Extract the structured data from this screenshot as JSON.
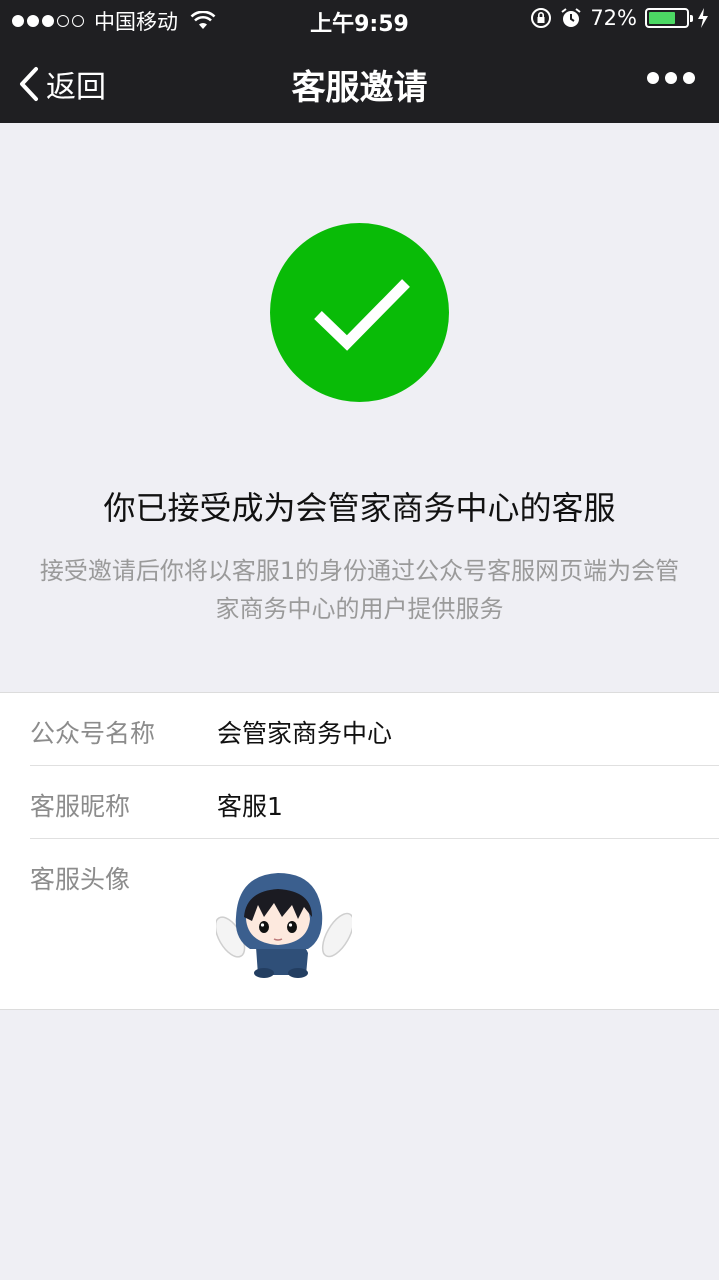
{
  "status_bar": {
    "carrier": "中国移动",
    "time": "上午9:59",
    "battery_percent": "72%",
    "battery_level": 0.72,
    "signal_bars_filled": 3,
    "signal_bars_total": 5
  },
  "nav": {
    "back_label": "返回",
    "title": "客服邀请"
  },
  "result": {
    "icon": "success-check-icon",
    "accent_color": "#09bb07",
    "headline": "你已接受成为会管家商务中心的客服",
    "description": "接受邀请后你将以客服1的身份通过公众号客服网页端为会管家商务中心的用户提供服务"
  },
  "info": {
    "rows": [
      {
        "label": "公众号名称",
        "value": "会管家商务中心"
      },
      {
        "label": "客服昵称",
        "value": "客服1"
      },
      {
        "label": "客服头像",
        "value": ""
      }
    ]
  }
}
